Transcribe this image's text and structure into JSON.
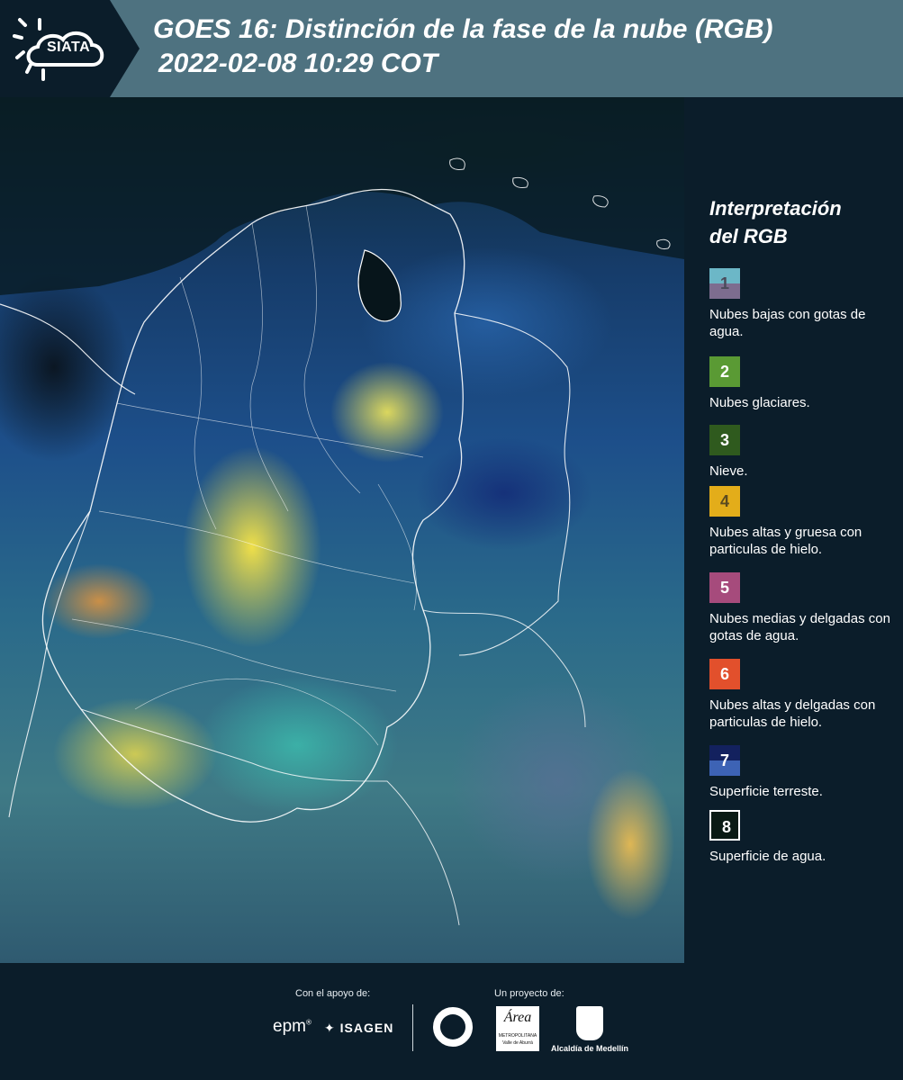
{
  "header": {
    "logo_text": "SIATA",
    "title_line1": "GOES 16: Distinción de la fase de la nube (RGB)",
    "title_line2": "2022-02-08 10:29 COT"
  },
  "legend": {
    "title_line1": "Interpretación",
    "title_line2": "del RGB",
    "items": [
      {
        "number": "1",
        "label": "Nubes bajas con gotas de agua.",
        "color_top": "#6cb7c7",
        "color_bottom": "#7d6d8f",
        "num_color": "#4a4a5a"
      },
      {
        "number": "2",
        "label": "Nubes glaciares.",
        "color_top": "#5a9a34",
        "color_bottom": "#5a9a34",
        "num_color": "#ffffff"
      },
      {
        "number": "3",
        "label": "Nieve.",
        "color_top": "#2f5a1e",
        "color_bottom": "#2f5a1e",
        "num_color": "#ffffff"
      },
      {
        "number": "4",
        "label": "Nubes altas y gruesa con particulas de hielo.",
        "color_top": "#e3ad1a",
        "color_bottom": "#e3ad1a",
        "num_color": "#5a4a20"
      },
      {
        "number": "5",
        "label": "Nubes medias y delgadas con gotas de agua.",
        "color_top": "#a64b7c",
        "color_bottom": "#a64b7c",
        "num_color": "#ffffff"
      },
      {
        "number": "6",
        "label": "Nubes altas y delgadas con particulas de hielo.",
        "color_top": "#e2502c",
        "color_bottom": "#e2502c",
        "num_color": "#ffffff"
      },
      {
        "number": "7",
        "label": "Superficie terreste.",
        "color_top": "#13215e",
        "color_bottom": "#3d63b5",
        "num_color": "#ffffff"
      },
      {
        "number": "8",
        "label": "Superficie de agua.",
        "color_top": "#0a1a14",
        "color_bottom": "#0a1a14",
        "num_color": "#ffffff"
      }
    ]
  },
  "footer": {
    "support_label": "Con el apoyo de:",
    "project_label": "Un proyecto de:",
    "sponsor_epm": "epm",
    "sponsor_isagen": "ISAGEN",
    "area_logo_text": "Área",
    "area_logo_sub": "METROPOLITANA",
    "area_logo_sub2": "Valle de Aburrá",
    "alcaldia": "Alcaldía de Medellín"
  }
}
